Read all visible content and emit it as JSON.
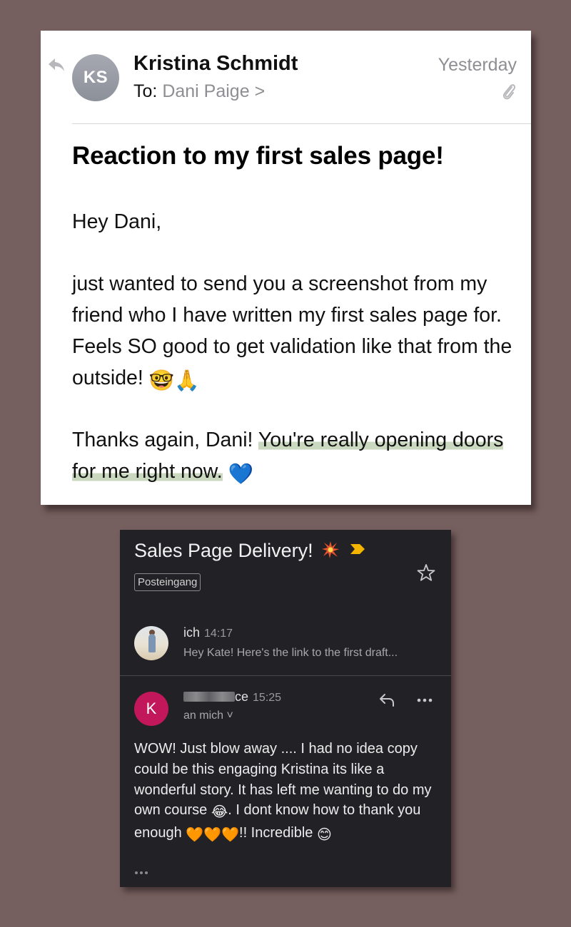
{
  "email": {
    "avatar_initials": "KS",
    "sender": "Kristina Schmidt",
    "to_label": "To:",
    "recipient": "Dani Paige",
    "recipient_chevron": ">",
    "date": "Yesterday",
    "subject": "Reaction to my first sales page!",
    "greeting": "Hey Dani,",
    "paragraph1": "just wanted to send you a screenshot from my friend who I have written my first sales page for. Feels SO good to get validation like that from the outside!",
    "paragraph1_emojis": "🤓🙏",
    "paragraph2_plain": "Thanks again, Dani! ",
    "paragraph2_highlight": "You're really opening doors for me right now.",
    "paragraph2_emoji": "💙",
    "highlight_color": "#a0b98c"
  },
  "gmail": {
    "subject": "Sales Page Delivery!",
    "label": "Posteingang",
    "messages": [
      {
        "sender": "ich",
        "time": "14:17",
        "snippet": "Hey Kate! Here's the link to the first draft..."
      },
      {
        "avatar_letter": "K",
        "sender_visible": "ce",
        "time": "15:25",
        "to": "an mich ˅",
        "body_part1": "WOW! Just blow away .... I had no idea copy could be this engaging Kristina its like a wonderful story. It has left me wanting to do my own course ",
        "emoji_laugh": "😂",
        "body_part2": ". I dont know how to thank you enough ",
        "hearts": "🧡🧡🧡",
        "body_part3": "!! Incredible ",
        "emoji_smile": "😊"
      }
    ],
    "avatar_color": "#c2185b"
  },
  "icons": [
    "reply-arrow-icon",
    "paperclip-icon",
    "spark-icon",
    "important-marker-icon",
    "star-icon",
    "reply-icon",
    "more-options-icon",
    "trimmed-content-icon"
  ]
}
